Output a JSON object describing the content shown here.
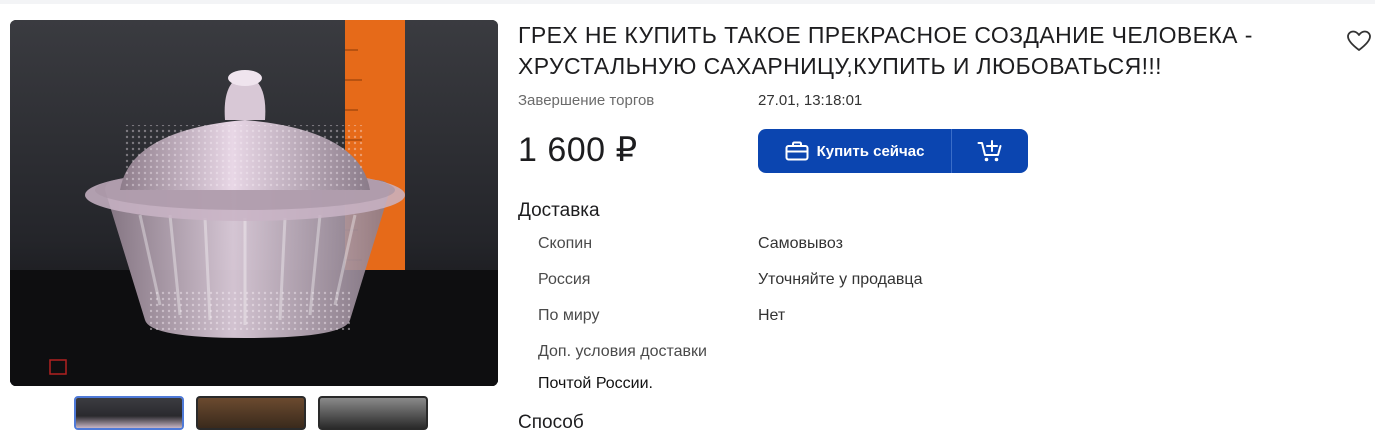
{
  "product": {
    "title": "ГРЕХ НЕ КУПИТЬ ТАКОЕ ПРЕКРАСНОЕ СОЗДАНИЕ ЧЕЛОВЕКА - ХРУСТАЛЬНУЮ САХАРНИЦУ,КУПИТЬ И ЛЮБОВАТЬСЯ!!!",
    "auction_end_label": "Завершение торгов",
    "auction_end_value": "27.01, 13:18:01",
    "price": "1 600 ₽",
    "buy_now_label": "Купить сейчас",
    "favorite_icon": "heart-outline-icon",
    "cart_icon": "cart-add-icon",
    "briefcase_icon": "briefcase-icon",
    "accent_color": "#0b45b0"
  },
  "delivery": {
    "title": "Доставка",
    "rows": [
      {
        "label": "Скопин",
        "value": "Самовывоз"
      },
      {
        "label": "Россия",
        "value": "Уточняйте у продавца"
      },
      {
        "label": "По миру",
        "value": "Нет"
      },
      {
        "label": "Доп. условия доставки",
        "value": ""
      }
    ],
    "extra_note": "Почтой России."
  },
  "next_section_peek": "Способ"
}
